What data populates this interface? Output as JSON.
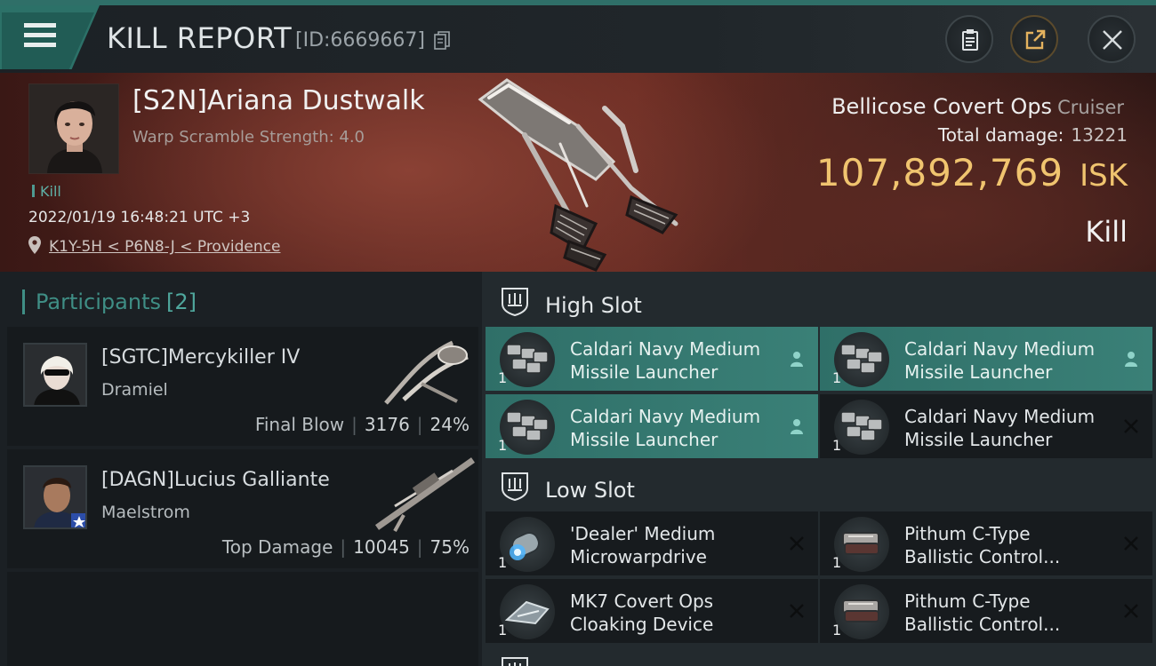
{
  "header": {
    "title": "KILL REPORT",
    "report_id": "[ID:6669667]"
  },
  "victim": {
    "name": "[S2N]Ariana Dustwalk",
    "scramble": "Warp Scramble Strength: 4.0",
    "kill_tag": "Kill",
    "datetime": "2022/01/19 16:48:21 UTC +3",
    "location": "K1Y-5H < P6N8-J < Providence",
    "ship_name": "Bellicose Covert Ops",
    "ship_class": "Cruiser",
    "total_damage_label": "Total damage:",
    "total_damage": "13221",
    "isk_value": "107,892,769",
    "isk_unit": "ISK",
    "result": "Kill"
  },
  "participants": {
    "label": "Participants",
    "count": "[2]",
    "items": [
      {
        "name": "[SGTC]Mercykiller IV",
        "ship": "Dramiel",
        "role": "Final Blow",
        "damage": "3176",
        "percent": "24%"
      },
      {
        "name": "[DAGN]Lucius Galliante",
        "ship": "Maelstrom",
        "role": "Top Damage",
        "damage": "10045",
        "percent": "75%"
      }
    ]
  },
  "slots": {
    "high": {
      "label": "High Slot",
      "items": [
        {
          "line1": "Caldari Navy Medium",
          "line2": "Missile Launcher",
          "qty": "1",
          "status": "person-icon"
        },
        {
          "line1": "Caldari Navy Medium",
          "line2": "Missile Launcher",
          "qty": "1",
          "status": "person-icon"
        },
        {
          "line1": "Caldari Navy Medium",
          "line2": "Missile Launcher",
          "qty": "1",
          "status": "person-icon"
        },
        {
          "line1": "Caldari Navy Medium",
          "line2": "Missile Launcher",
          "qty": "1",
          "status": "destroyed-x-icon"
        }
      ]
    },
    "low": {
      "label": "Low Slot",
      "items": [
        {
          "line1": "'Dealer' Medium",
          "line2": "Microwarpdrive",
          "qty": "1",
          "status": "destroyed-x-icon"
        },
        {
          "line1": "Pithum C-Type",
          "line2": "Ballistic Control...",
          "qty": "1",
          "status": "destroyed-x-icon"
        },
        {
          "line1": "MK7 Covert Ops",
          "line2": "Cloaking Device",
          "qty": "1",
          "status": "destroyed-x-icon"
        },
        {
          "line1": "Pithum C-Type",
          "line2": "Ballistic Control...",
          "qty": "1",
          "status": "destroyed-x-icon"
        }
      ]
    }
  },
  "colors": {
    "accent": "#2f6f68",
    "isk": "#f0c46f",
    "highlight": "#3a8077"
  }
}
